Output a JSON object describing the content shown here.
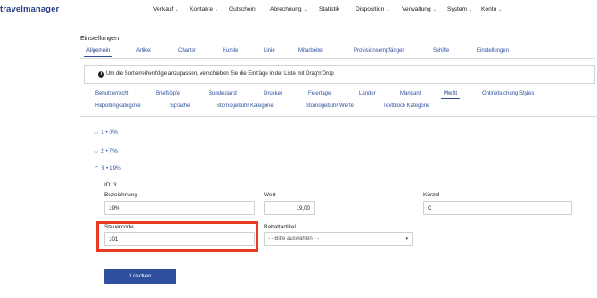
{
  "app": {
    "logo_text": "travelmanager"
  },
  "nav": {
    "items": [
      {
        "label": "Verkauf",
        "dropdown": true
      },
      {
        "label": "Kontakte",
        "dropdown": true
      },
      {
        "label": "Gutschein",
        "dropdown": false
      },
      {
        "label": "Abrechnung",
        "dropdown": true
      },
      {
        "label": "Statistik",
        "dropdown": false
      },
      {
        "label": "Disposition",
        "dropdown": true
      },
      {
        "label": "Verwaltung",
        "dropdown": true
      },
      {
        "label": "System",
        "dropdown": true
      },
      {
        "label": "Konto",
        "dropdown": true
      }
    ]
  },
  "page": {
    "title": "Einstellungen"
  },
  "main_tabs": [
    {
      "label": "Allgemein",
      "active": true
    },
    {
      "label": "Artikel",
      "active": false
    },
    {
      "label": "Charter",
      "active": false
    },
    {
      "label": "Kunde",
      "active": false
    },
    {
      "label": "Linie",
      "active": false
    },
    {
      "label": "Mitarbeiter",
      "active": false
    },
    {
      "label": "Provisionsempfänger",
      "active": false
    },
    {
      "label": "Schiffe",
      "active": false
    },
    {
      "label": "Einstellungen",
      "active": false
    }
  ],
  "info": {
    "text": "Um die Sortierreihenfolge anzupassen, verschieben Sie die Einträge in der Liste mit Drag'n'Drop"
  },
  "sub_tabs": {
    "row1": [
      {
        "label": "Benutzerrecht",
        "active": false
      },
      {
        "label": "Briefköpfe",
        "active": false
      },
      {
        "label": "Bundesland",
        "active": false
      },
      {
        "label": "Drucker",
        "active": false
      },
      {
        "label": "Feiertage",
        "active": false
      },
      {
        "label": "Länder",
        "active": false
      },
      {
        "label": "Mandant",
        "active": false
      },
      {
        "label": "MwSt",
        "active": true
      },
      {
        "label": "Onlinebuchung Styles",
        "active": false
      }
    ],
    "row2": [
      {
        "label": "Reportingkategorie",
        "active": false
      },
      {
        "label": "Sprache",
        "active": false
      },
      {
        "label": "Stornogebühr Kategorie",
        "active": false
      },
      {
        "label": "Stornogebühr Werte",
        "active": false
      },
      {
        "label": "Textblock Kategorie",
        "active": false
      }
    ]
  },
  "tax_entries": [
    {
      "label": "1 • 0%",
      "expanded": false
    },
    {
      "label": "2 • 7%",
      "expanded": false
    },
    {
      "label": "3 • 19%",
      "expanded": true
    }
  ],
  "detail": {
    "id_text": "ID: 3",
    "bezeichnung_label": "Bezeichnung",
    "bezeichnung_value": "19%",
    "wert_label": "Wert",
    "wert_value": "19,00",
    "kuerzel_label": "Kürzel",
    "kuerzel_value": "C",
    "steuercode_label": "Steuercode",
    "steuercode_value": "101",
    "rabattartikel_label": "Rabattartikel",
    "rabattartikel_selected": "- - Bitte auswählen - -",
    "delete_label": "Löschen"
  },
  "colors": {
    "brand": "#2d4f9e",
    "highlight": "#e63b1f"
  }
}
